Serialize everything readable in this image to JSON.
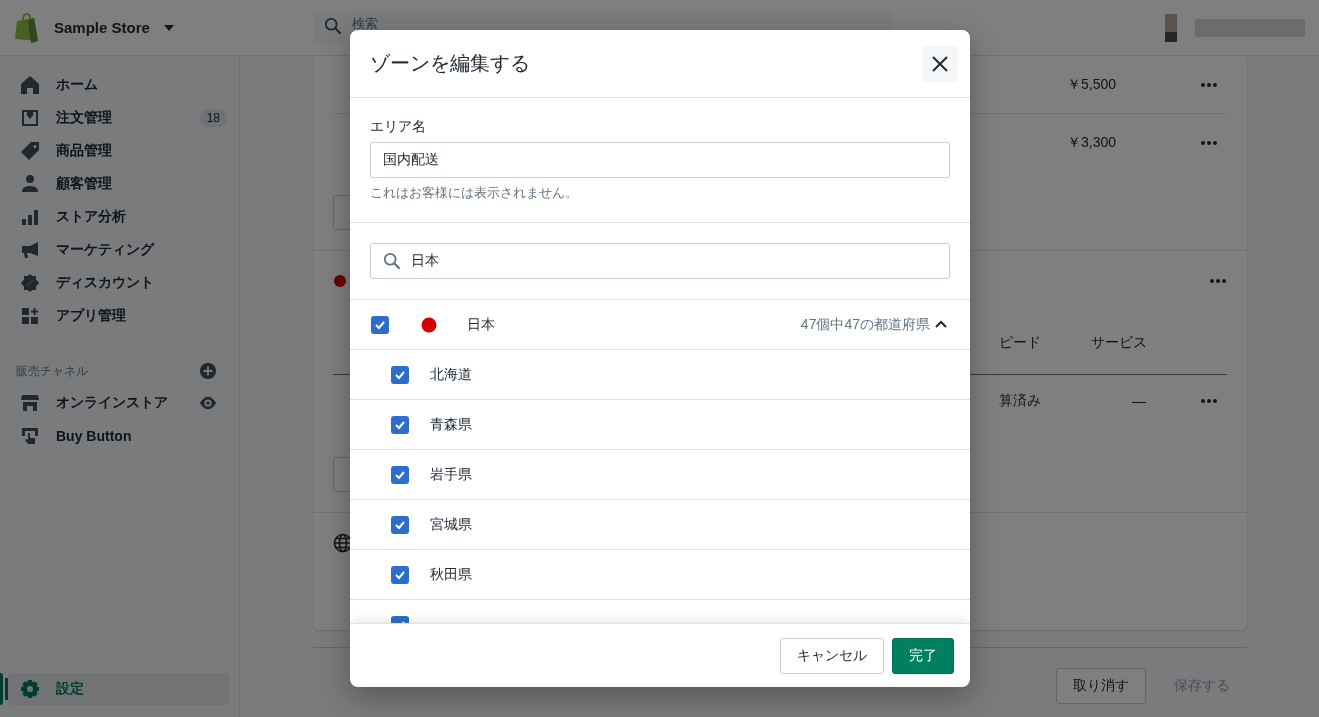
{
  "topbar": {
    "store_name": "Sample Store",
    "search": {
      "placeholder": "検索"
    }
  },
  "sidebar": {
    "items": [
      {
        "kind": "home",
        "label": "ホーム",
        "selected": false
      },
      {
        "kind": "orders",
        "label": "注文管理",
        "badge": "18",
        "selected": false
      },
      {
        "kind": "tag",
        "label": "商品管理",
        "selected": false
      },
      {
        "kind": "person",
        "label": "顧客管理",
        "selected": false
      },
      {
        "kind": "chart",
        "label": "ストア分析",
        "selected": false
      },
      {
        "kind": "megaphone",
        "label": "マーケティング",
        "selected": false
      },
      {
        "kind": "discount",
        "label": "ディスカウント",
        "selected": false
      },
      {
        "kind": "apps",
        "label": "アプリ管理",
        "selected": false
      }
    ],
    "channels_heading": "販売チャネル",
    "channels": [
      {
        "kind": "store",
        "label": "オンラインストア"
      },
      {
        "kind": "buy",
        "label": "Buy Button"
      }
    ],
    "settings": {
      "label": "設定",
      "selected": true
    }
  },
  "content": {
    "rates": [
      {
        "price": "￥5,500"
      },
      {
        "price": "￥3,300"
      }
    ],
    "table_headers": [
      "ピード",
      "サービス"
    ],
    "table_rows": [
      {
        "cells": [
          "算済み",
          "—"
        ]
      }
    ],
    "footer_buttons": [
      {
        "label": "取り消す",
        "disabled": false
      },
      {
        "label": "保存する",
        "disabled": true
      }
    ]
  },
  "modal": {
    "title": "ゾーンを編集する",
    "area_name": {
      "label": "エリア名",
      "value": "国内配送",
      "help": "これはお客様には表示されません。"
    },
    "search": {
      "value": "日本"
    },
    "country": {
      "name": "日本",
      "checked": true,
      "summary": "47個中47の都道府県",
      "expanded": true
    },
    "regions": [
      {
        "name": "北海道",
        "checked": true
      },
      {
        "name": "青森県",
        "checked": true
      },
      {
        "name": "岩手県",
        "checked": true
      },
      {
        "name": "宮城県",
        "checked": true
      },
      {
        "name": "秋田県",
        "checked": true
      },
      {
        "checked": true
      }
    ],
    "buttons": {
      "cancel": "キャンセル",
      "done": "完了"
    }
  }
}
